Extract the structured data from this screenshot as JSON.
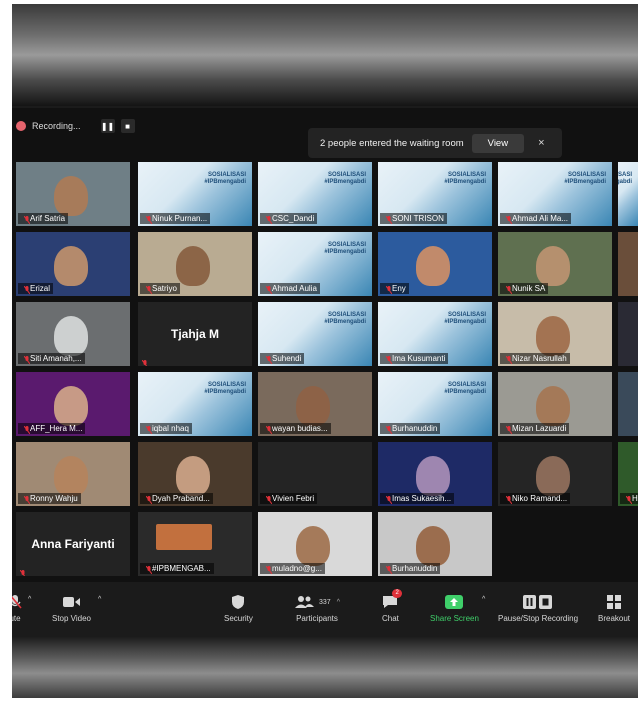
{
  "recording": {
    "label": "Recording..."
  },
  "waiting_room": {
    "message": "2 people entered the waiting room",
    "view_label": "View",
    "close_glyph": "×"
  },
  "tiles": [
    {
      "name": "Arif Satria",
      "type": "camera",
      "bg": "#6f7f86",
      "skin": "#a77b5a",
      "active": true
    },
    {
      "name": "Ninuk Purnan...",
      "type": "slide"
    },
    {
      "name": "CSC_Dandi",
      "type": "slide"
    },
    {
      "name": "SONI TRISON",
      "type": "slide"
    },
    {
      "name": "Ahmad Ali Ma...",
      "type": "slide"
    },
    {
      "name": "",
      "type": "slide"
    },
    {
      "name": "Erizal",
      "type": "camera",
      "bg": "#2b3f73",
      "skin": "#b48a6c"
    },
    {
      "name": "Satriyo",
      "type": "camera",
      "bg": "#b9ab92",
      "skin": "#8c6547"
    },
    {
      "name": "Ahmad Aulia",
      "type": "slide"
    },
    {
      "name": "Eny",
      "type": "camera",
      "bg": "#2c5b9e",
      "skin": "#c18a6b"
    },
    {
      "name": "Nunik SA",
      "type": "camera",
      "bg": "#5f7050",
      "skin": "#b5906e"
    },
    {
      "name": "",
      "type": "camera",
      "bg": "#6a4e3a",
      "skin": "#a37b5e"
    },
    {
      "name": "Siti Amanah,...",
      "type": "camera",
      "bg": "#6b6e70",
      "skin": "#cdd0d0"
    },
    {
      "name": "",
      "type": "label",
      "big": "Tjahja M"
    },
    {
      "name": "Suhendi",
      "type": "slide"
    },
    {
      "name": "Ima Kusumanti",
      "type": "slide"
    },
    {
      "name": "Nizar Nasrullah",
      "type": "camera",
      "bg": "#c7bca9",
      "skin": "#a37352"
    },
    {
      "name": "",
      "type": "camera",
      "bg": "#2a2a34",
      "skin": "#403838"
    },
    {
      "name": "AFF_Hera M...",
      "type": "camera",
      "bg": "#5a1a6e",
      "skin": "#c79a86"
    },
    {
      "name": "iqbal nhaq",
      "type": "slide"
    },
    {
      "name": "wayan budias...",
      "type": "camera",
      "bg": "#7a6a5c",
      "skin": "#8d6247"
    },
    {
      "name": "Burhanuddin",
      "type": "slide"
    },
    {
      "name": "Mizan Lazuardi",
      "type": "camera",
      "bg": "#9b9a93",
      "skin": "#a47958"
    },
    {
      "name": "",
      "type": "camera",
      "bg": "#3a4a5a",
      "skin": "#5c4a3c"
    },
    {
      "name": "Ronny Wahju",
      "type": "camera",
      "bg": "#a08a74",
      "skin": "#b3845f"
    },
    {
      "name": "Dyah Praband...",
      "type": "camera",
      "bg": "#4a3a2c",
      "skin": "#c49c80"
    },
    {
      "name": "Vivien Febri",
      "type": "empty"
    },
    {
      "name": "Imas Sukaesih...",
      "type": "camera",
      "bg": "#1e2a66",
      "skin": "#9e86b0"
    },
    {
      "name": "Niko Ramand...",
      "type": "camera",
      "bg": "#252525",
      "skin": "#8a6a58"
    },
    {
      "name": "Henry KHS",
      "type": "camera",
      "bg": "#2f5a2a",
      "skin": "#9c6d4f"
    },
    {
      "name": "",
      "type": "label",
      "big": "Anna Fariyanti"
    },
    {
      "name": "#IPBMENGAB...",
      "type": "photo",
      "bg": "#2a2a2a",
      "skin": "#c2703e"
    },
    {
      "name": "muladno@g...",
      "type": "camera",
      "bg": "#d9d9d9",
      "skin": "#a57a5a"
    },
    {
      "name": "Burhanuddin",
      "type": "camera",
      "bg": "#c8c8c8",
      "skin": "#9b6d4e"
    }
  ],
  "slide_text": "SOSIALISASI\n#IPBmengabdi",
  "toolbar": {
    "mute_label": "ute",
    "stop_video_label": "Stop Video",
    "security_label": "Security",
    "participants_label": "Participants",
    "participants_count": "337",
    "chat_label": "Chat",
    "chat_badge": "2",
    "share_label": "Share Screen",
    "pause_label": "Pause/Stop Recording",
    "breakout_label": "Breakout"
  },
  "colors": {
    "accent_green": "#3fcf6a",
    "active_border": "#c8e86b",
    "mic_red": "#e0313a",
    "background": "#1b1b1b"
  }
}
